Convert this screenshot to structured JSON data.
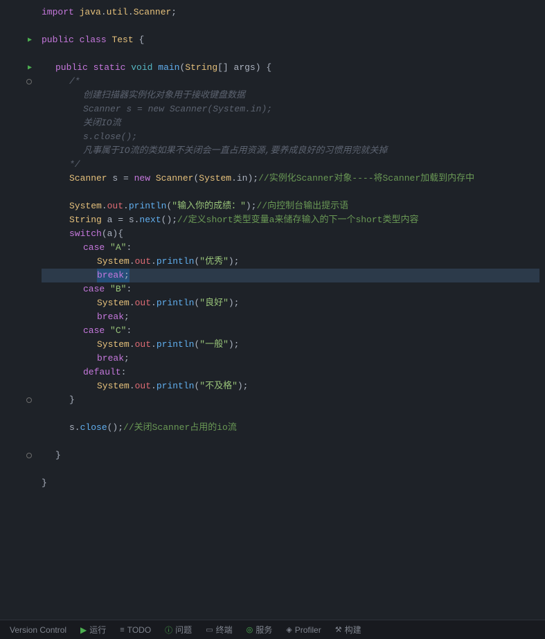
{
  "editor": {
    "lines": [
      {
        "gutter": "",
        "content": "import_line"
      },
      {
        "gutter": "",
        "content": "blank"
      },
      {
        "gutter": "run",
        "content": "class_decl"
      },
      {
        "gutter": "",
        "content": "blank"
      },
      {
        "gutter": "run",
        "content": "main_decl"
      },
      {
        "gutter": "bp_hollow",
        "content": "comment_open"
      },
      {
        "gutter": "",
        "content": "comment_1"
      },
      {
        "gutter": "",
        "content": "comment_2"
      },
      {
        "gutter": "",
        "content": "comment_3"
      },
      {
        "gutter": "",
        "content": "comment_4"
      },
      {
        "gutter": "",
        "content": "comment_5"
      },
      {
        "gutter": "",
        "content": "comment_close"
      },
      {
        "gutter": "",
        "content": "scanner_new"
      },
      {
        "gutter": "",
        "content": "blank"
      },
      {
        "gutter": "",
        "content": "println_1"
      },
      {
        "gutter": "",
        "content": "string_a"
      },
      {
        "gutter": "",
        "content": "switch_line"
      },
      {
        "gutter": "",
        "content": "case_A"
      },
      {
        "gutter": "",
        "content": "println_A"
      },
      {
        "gutter": "",
        "content": "break_A"
      },
      {
        "gutter": "",
        "content": "case_B"
      },
      {
        "gutter": "",
        "content": "println_B"
      },
      {
        "gutter": "",
        "content": "break_B"
      },
      {
        "gutter": "",
        "content": "case_C"
      },
      {
        "gutter": "",
        "content": "println_C"
      },
      {
        "gutter": "",
        "content": "break_C"
      },
      {
        "gutter": "",
        "content": "default_line"
      },
      {
        "gutter": "",
        "content": "println_default"
      },
      {
        "gutter": "bp_hollow",
        "content": "close_brace_1"
      },
      {
        "gutter": "",
        "content": "blank"
      },
      {
        "gutter": "",
        "content": "s_close"
      },
      {
        "gutter": "",
        "content": "blank"
      },
      {
        "gutter": "bp_hollow",
        "content": "close_brace_2"
      },
      {
        "gutter": "",
        "content": "blank"
      },
      {
        "gutter": "",
        "content": "close_brace_3"
      }
    ]
  },
  "statusbar": {
    "items": [
      {
        "icon": "git",
        "label": "Version Control"
      },
      {
        "icon": "run",
        "label": "运行"
      },
      {
        "icon": "todo",
        "label": "TODO"
      },
      {
        "icon": "info",
        "label": "问题"
      },
      {
        "icon": "terminal",
        "label": "终端"
      },
      {
        "icon": "service",
        "label": "服务"
      },
      {
        "icon": "profiler",
        "label": "Profiler"
      },
      {
        "icon": "build",
        "label": "构建"
      }
    ]
  }
}
